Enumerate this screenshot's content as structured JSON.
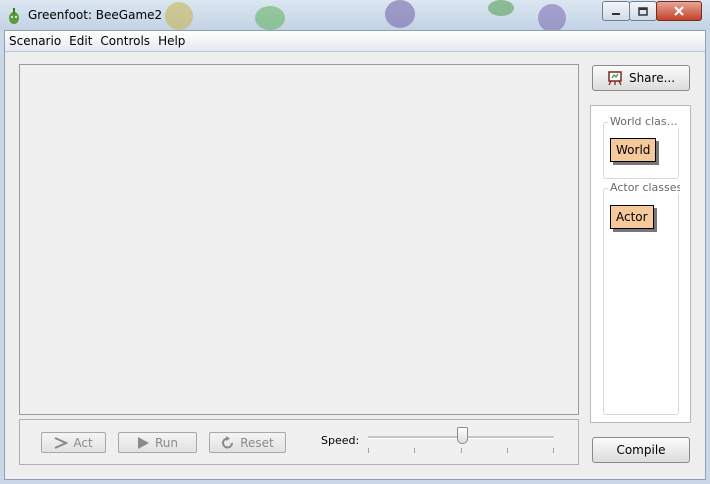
{
  "window": {
    "title": "Greenfoot: BeeGame2",
    "minimize_icon": "minimize-icon",
    "maximize_icon": "maximize-icon",
    "close_icon": "close-icon"
  },
  "menu": [
    "Scenario",
    "Edit",
    "Controls",
    "Help"
  ],
  "share_button": {
    "label": "Share...",
    "icon": "easel-icon"
  },
  "class_panel": {
    "world_group_label": "World clas…",
    "world_class": "World",
    "actor_group_label": "Actor classes",
    "actor_class": "Actor"
  },
  "controls": {
    "act_label": "Act",
    "run_label": "Run",
    "reset_label": "Reset",
    "speed_label": "Speed:",
    "speed_value": 0.5,
    "disabled_color": "#8a8a8a"
  },
  "compile_button": {
    "label": "Compile"
  }
}
